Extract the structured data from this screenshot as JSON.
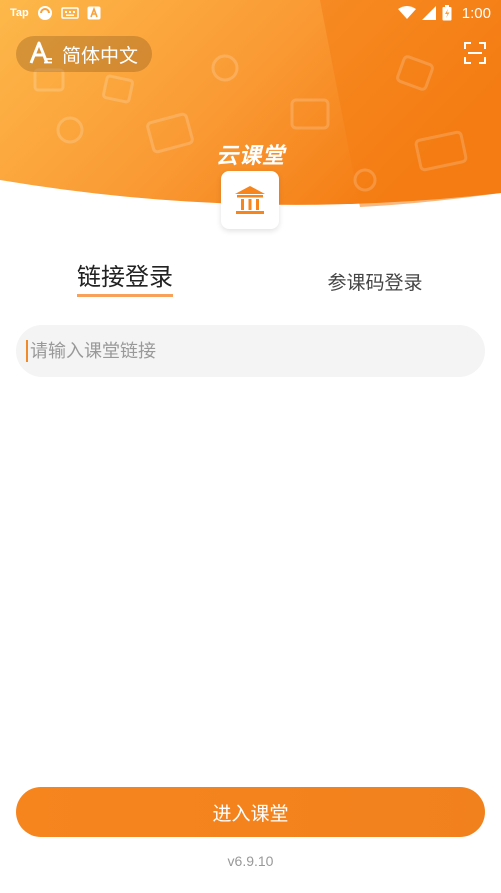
{
  "status_bar": {
    "left_text": "Tap",
    "time": "1:00"
  },
  "header": {
    "language_label": "简体中文",
    "brand": "云课堂",
    "colors": {
      "primary": "#f7851e",
      "light": "#fdb84a"
    }
  },
  "tabs": [
    {
      "label": "链接登录",
      "active": true
    },
    {
      "label": "参课码登录",
      "active": false
    }
  ],
  "link_input": {
    "value": "",
    "placeholder": "请输入课堂链接"
  },
  "enter_button": {
    "label": "进入课堂"
  },
  "version": "v6.9.10",
  "icons": {
    "language": "translate-icon",
    "scan": "scan-icon",
    "logo": "classroom-building-icon"
  }
}
